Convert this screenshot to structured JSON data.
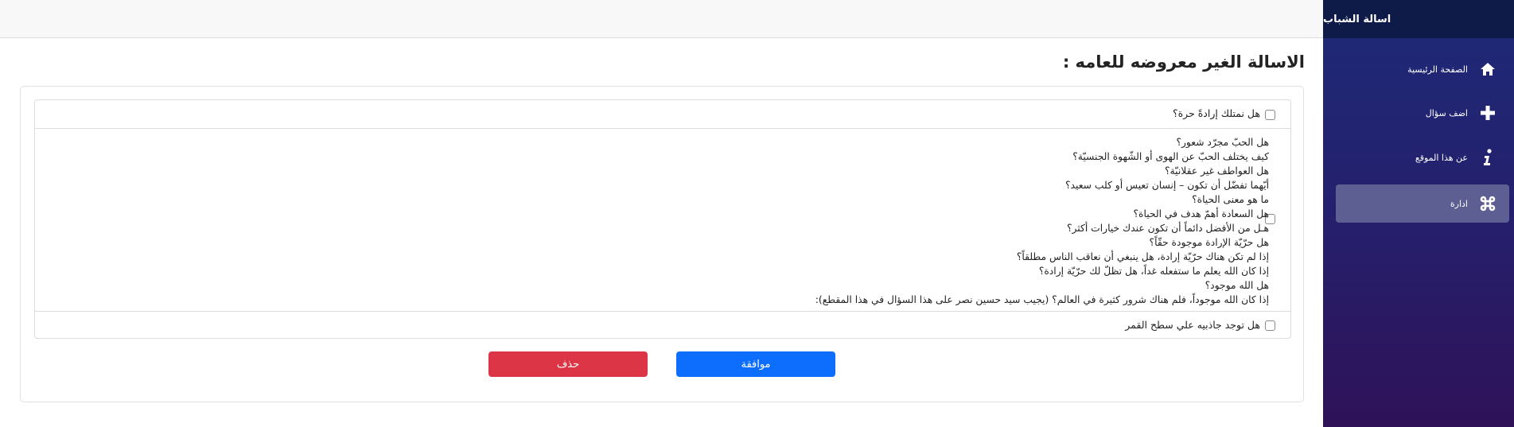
{
  "app": {
    "title": "اسالة الشباب"
  },
  "sidebar": {
    "items": [
      {
        "label": "الصفحة الرئيسية",
        "icon": "home-icon"
      },
      {
        "label": "اضف سؤال",
        "icon": "plus-icon"
      },
      {
        "label": "عن هذا الموقع",
        "icon": "info-icon"
      },
      {
        "label": "ادارة",
        "icon": "command-icon",
        "active": true
      }
    ]
  },
  "main": {
    "title": "الاسالة الغير معروضه للعامه :",
    "questions": [
      {
        "text": "هل نمتلك إرادةً حرة؟"
      },
      {
        "lines": [
          "هل الحبّ مجرّد شعور؟",
          "كيف يختلف الحبّ عن الهوى أو الشّهوة الجنسيّة؟",
          "هل العواطف غير عقلانيّة؟",
          "أيّهما تفضّل أن تكون – إنسان تعيس أو كلب سعيد؟",
          "ما هو معنى الحياة؟",
          "هل السعادة أهمّ هدف في الحياة؟",
          "هـل من الأفضل دائماً أن تكون عندك خيارات أكثر؟",
          "هل حرّيّة الإرادة موجودة حقّاً؟",
          "إذا لم تكن هناك حرّيّة إرادة، هل ينبغي أن نعاقب الناس مطلقاً؟",
          "إذا كان الله يعلم ما ستفعله غداً، هل تظلّ لك حرّيّة إرادة؟",
          "هل الله موجود؟",
          "إذا كان الله موجوداً، فلم هناك شرور كثيرة في العالم؟ (يجيب سيد حسين نصر على هذا السؤال في هذا المقطع):"
        ]
      },
      {
        "text": "هل توجد جاذبيه علي سطح القمر"
      }
    ],
    "actions": {
      "approve_label": "موافقة",
      "delete_label": "حذف"
    }
  },
  "colors": {
    "approve": "#0d6efd",
    "delete": "#dc3545",
    "sidebar_top": "#0e1a47",
    "sidebar_active": "#5d5f93"
  }
}
